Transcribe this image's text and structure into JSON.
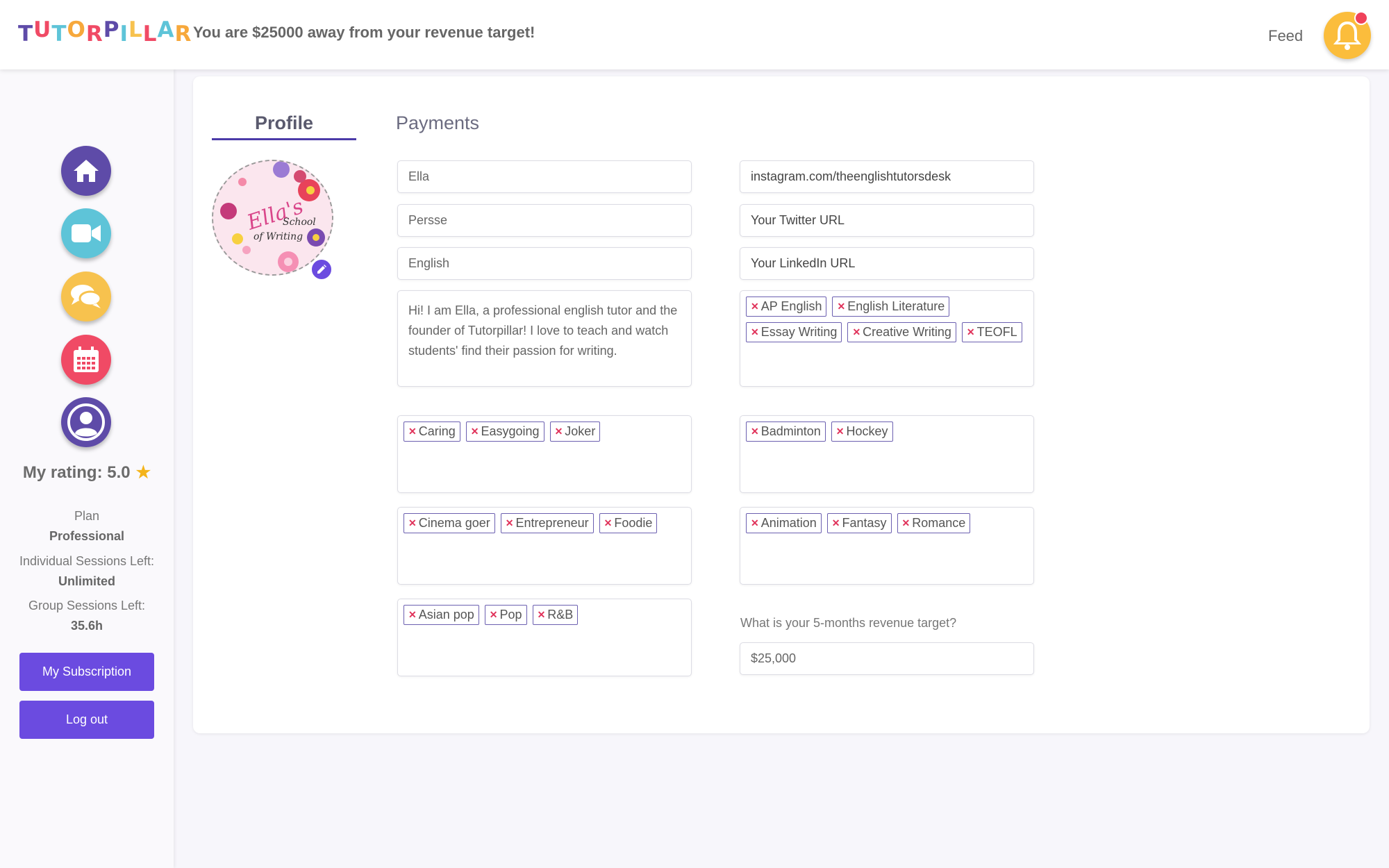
{
  "header": {
    "logo_letters": [
      {
        "ch": "T",
        "color": "#5e4ba8"
      },
      {
        "ch": "U",
        "color": "#f04a65"
      },
      {
        "ch": "T",
        "color": "#5ec4d8"
      },
      {
        "ch": "O",
        "color": "#f7a83b"
      },
      {
        "ch": "R",
        "color": "#f04a65"
      },
      {
        "ch": "P",
        "color": "#5e4ba8"
      },
      {
        "ch": "I",
        "color": "#5ec4d8"
      },
      {
        "ch": "L",
        "color": "#f7c24e"
      },
      {
        "ch": "L",
        "color": "#f04a65"
      },
      {
        "ch": "A",
        "color": "#5ec4d8"
      },
      {
        "ch": "R",
        "color": "#f7a83b"
      }
    ],
    "announcement": "You are $25000 away from your revenue target!",
    "feed_label": "Feed",
    "bell_icon": "bell-icon"
  },
  "sidebar": {
    "nav": [
      {
        "name": "home",
        "icon": "home-icon"
      },
      {
        "name": "video",
        "icon": "video-camera-icon"
      },
      {
        "name": "chat",
        "icon": "chat-icon"
      },
      {
        "name": "calendar",
        "icon": "calendar-icon"
      },
      {
        "name": "profile",
        "icon": "user-profile-icon"
      }
    ],
    "rating_label": "My rating: 5.0",
    "rating_star": "★",
    "plan_label": "Plan",
    "plan_value": "Professional",
    "individual_label": "Individual Sessions Left:",
    "individual_value": "Unlimited",
    "group_label": "Group Sessions Left:",
    "group_value": "35.6h",
    "subscription_button": "My Subscription",
    "logout_button": "Log out"
  },
  "tabs": {
    "profile": "Profile",
    "payments": "Payments",
    "active": "Profile"
  },
  "avatar": {
    "line1": "Ella's",
    "line2": "School",
    "line3": "of Writing"
  },
  "form": {
    "first_name": "Ella",
    "last_name": "Persse",
    "subject": "English",
    "bio": "Hi! I am Ella, a professional english tutor and the founder of Tutorpillar! I love to teach and watch students' find their passion for writing.",
    "instagram": "instagram.com/theenglishtutorsdesk",
    "twitter_placeholder": "Your Twitter URL",
    "linkedin_placeholder": "Your LinkedIn URL",
    "specialties": [
      "AP English",
      "English Literature",
      "Essay Writing",
      "Creative Writing",
      "TEOFL"
    ],
    "personality": [
      "Caring",
      "Easygoing",
      "Joker"
    ],
    "sports": [
      "Badminton",
      "Hockey"
    ],
    "interests": [
      "Cinema goer",
      "Entrepreneur",
      "Foodie"
    ],
    "genres": [
      "Animation",
      "Fantasy",
      "Romance"
    ],
    "music": [
      "Asian pop",
      "Pop",
      "R&B"
    ],
    "revenue_question": "What is your 5-months revenue target?",
    "revenue_value": "$25,000"
  },
  "colors": {
    "accent": "#6b4be0",
    "tab_underline": "#4b3aa8",
    "tag_border": "#6b5fb0",
    "tag_remove": "#e0325a",
    "bell": "#fbbd3c",
    "notification_dot": "#f0425a"
  }
}
